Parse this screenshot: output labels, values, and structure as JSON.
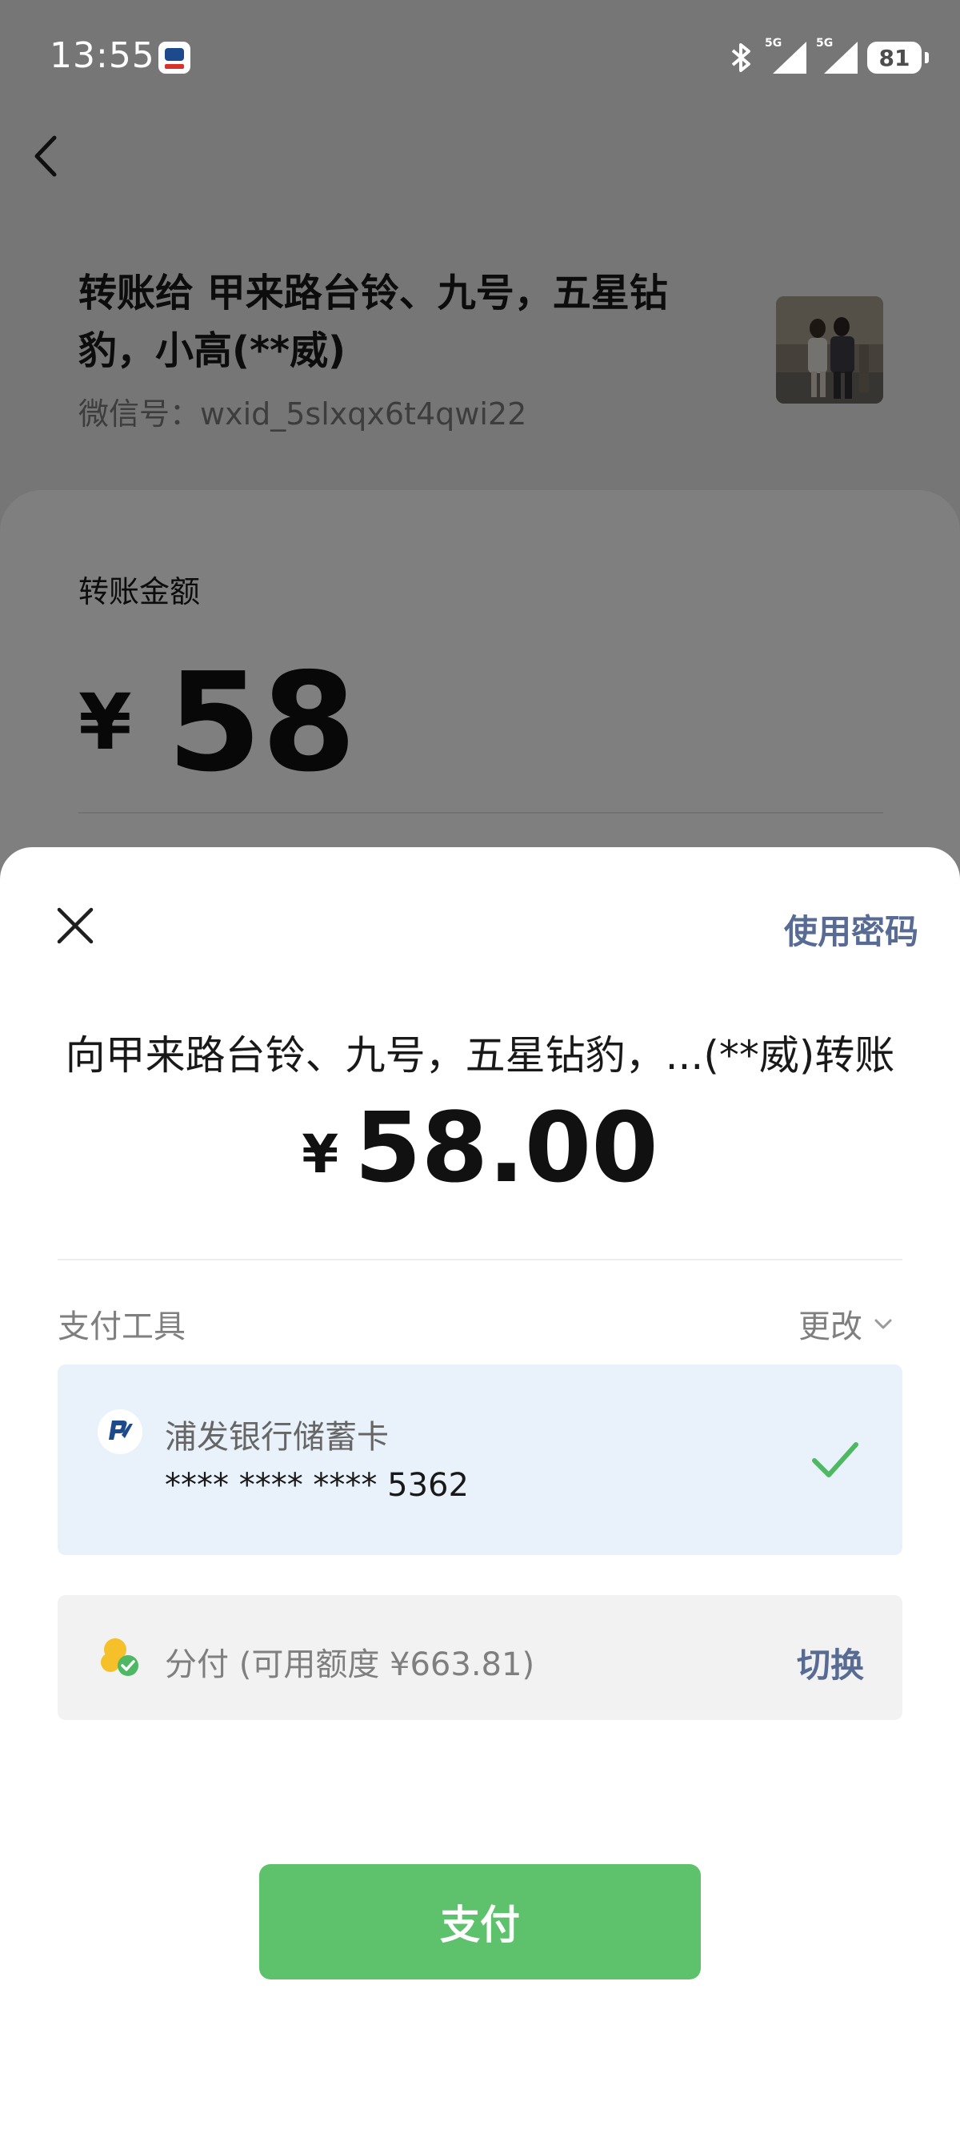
{
  "status_bar": {
    "time": "13:55",
    "network1": "5G",
    "network2": "5G",
    "battery": "81"
  },
  "header": {
    "title": "转账给 甲来路台铃、九号，五星钻豹，小高(**威)",
    "wxid": "微信号：wxid_5slxqx6t4qwi22"
  },
  "transfer": {
    "amount_label": "转账金额",
    "currency": "¥",
    "amount": "58"
  },
  "sheet": {
    "use_password": "使用密码",
    "pay_to": "向甲来路台铃、九号，五星钻豹，...(**威)转账",
    "currency": "¥",
    "amount": "58.00",
    "payment_tool_label": "支付工具",
    "change_label": "更改",
    "selected_card": {
      "name": "浦发银行储蓄卡",
      "number": "**** **** **** 5362"
    },
    "installment": {
      "text": "分付 (可用额度 ¥663.81)",
      "switch_label": "切换"
    },
    "pay_button": "支付"
  },
  "colors": {
    "accent_green": "#5ec16c",
    "link_blue": "#576b95",
    "selected_bg": "#e9f1fa",
    "check_green": "#4fb863"
  }
}
